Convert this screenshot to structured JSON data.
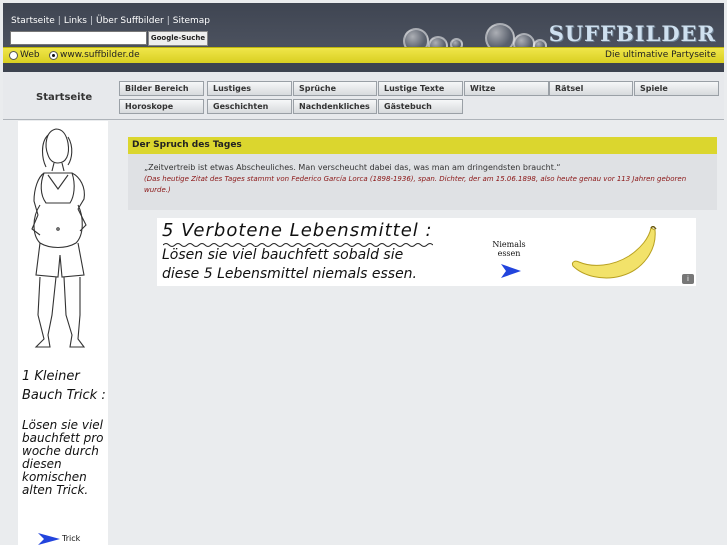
{
  "header": {
    "links": [
      "Startseite",
      "Links",
      "Über Suffbilder",
      "Sitemap"
    ],
    "search_button": "Google-Suche",
    "search_value": "",
    "radio_web": "Web",
    "radio_site": "www.suffbilder.de",
    "logo": "SUFFBILDER",
    "tagline": "Die ultimative Partyseite"
  },
  "nav": {
    "title": "Startseite",
    "row1": [
      "Bilder Bereich",
      "Lustiges",
      "Sprüche",
      "Lustige Texte",
      "Witze",
      "Rätsel",
      "Spiele"
    ],
    "row2": [
      "Horoskope",
      "Geschichten",
      "Nachdenkliches",
      "Gästebuch"
    ]
  },
  "sidebar": {
    "heading": "1 Kleiner Bauch Trick :",
    "body": "Lösen sie viel bauchfett pro woche durch diesen komischen alten Trick.",
    "cta": "Trick"
  },
  "spruch": {
    "heading": "Der Spruch des Tages",
    "quote": "„Zeitvertreib ist etwas Abscheuliches. Man verscheucht dabei das, was man am dringendsten braucht.“",
    "info": "(Das heutige Zitat des Tages stammt von Federico García Lorca (1898-1936), span. Dichter, der am 15.06.1898, also heute genau vor 113 Jahren geboren wurde.)"
  },
  "ad": {
    "title": "5 Verbotene Lebensmittel :",
    "line1": "Lösen sie viel bauchfett sobald sie",
    "line2": "diese 5 Lebensmittel niemals essen.",
    "niemals": "Niemals essen",
    "info": "i"
  },
  "colors": {
    "yellow": "#dbd62e",
    "header_dark": "#3f4552",
    "quote_info": "#8a1414"
  }
}
